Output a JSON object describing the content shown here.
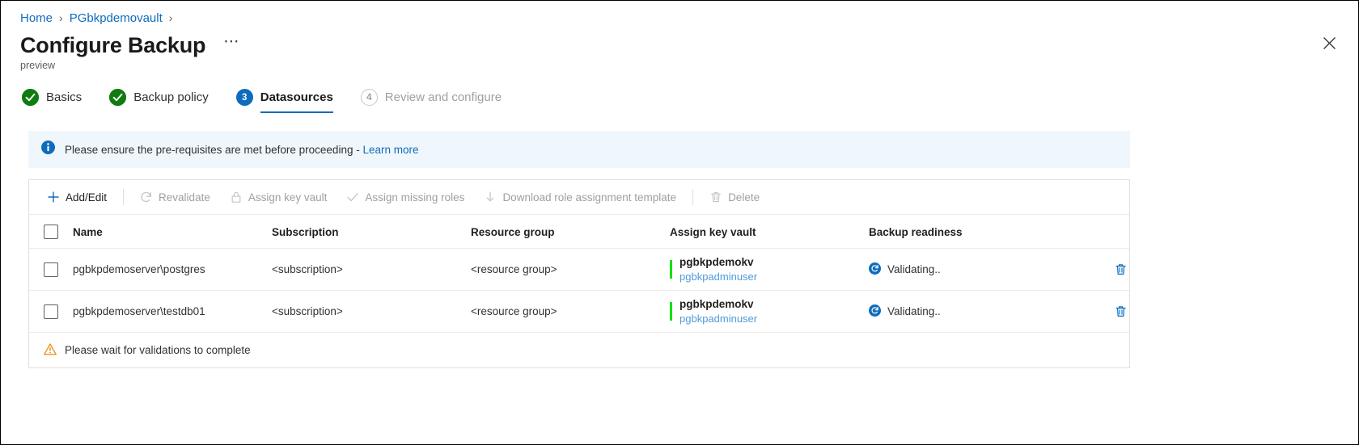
{
  "breadcrumb": {
    "items": [
      {
        "label": "Home"
      },
      {
        "label": "PGbkpdemovault"
      }
    ],
    "separator": "›"
  },
  "header": {
    "title": "Configure Backup",
    "subtitle": "preview",
    "more_label": "⋯",
    "close_icon": "close-icon"
  },
  "stepper": {
    "steps": [
      {
        "label": "Basics",
        "state": "done",
        "badge": "✓"
      },
      {
        "label": "Backup policy",
        "state": "done",
        "badge": "✓"
      },
      {
        "label": "Datasources",
        "state": "current",
        "badge": "3"
      },
      {
        "label": "Review and configure",
        "state": "todo",
        "badge": "4"
      }
    ]
  },
  "info_banner": {
    "icon": "info-icon",
    "message": "Please ensure the pre-requisites are met before proceeding - ",
    "link_label": "Learn more"
  },
  "commandbar": {
    "items": [
      {
        "label": "Add/Edit",
        "icon": "plus-icon",
        "enabled": true
      },
      {
        "label": "Revalidate",
        "icon": "refresh-icon",
        "enabled": false
      },
      {
        "label": "Assign key vault",
        "icon": "lock-icon",
        "enabled": false
      },
      {
        "label": "Assign missing roles",
        "icon": "check-icon",
        "enabled": false
      },
      {
        "label": "Download role assignment template",
        "icon": "download-icon",
        "enabled": false
      },
      {
        "label": "Delete",
        "icon": "trash-icon",
        "enabled": false
      }
    ]
  },
  "table": {
    "columns": [
      "Name",
      "Subscription",
      "Resource group",
      "Assign key vault",
      "Backup readiness"
    ],
    "rows": [
      {
        "name": "pgbkpdemoserver\\postgres",
        "subscription": "<subscription>",
        "resource_group": "<resource group>",
        "key_vault": "pgbkpdemokv",
        "key_vault_user": "pgbkpadminuser",
        "readiness": "Validating..",
        "readiness_icon": "sync-icon",
        "delete_icon": "trash-icon"
      },
      {
        "name": "pgbkpdemoserver\\testdb01",
        "subscription": "<subscription>",
        "resource_group": "<resource group>",
        "key_vault": "pgbkpdemokv",
        "key_vault_user": "pgbkpadminuser",
        "readiness": "Validating..",
        "readiness_icon": "sync-icon",
        "delete_icon": "trash-icon"
      }
    ]
  },
  "footer": {
    "icon": "warning-icon",
    "message": "Please wait for validations to complete"
  },
  "colors": {
    "accent": "#0f6cbd",
    "success": "#107c10",
    "kv_accent": "#13e213",
    "warning": "#e88c0b",
    "banner_bg": "#eff6fc"
  }
}
